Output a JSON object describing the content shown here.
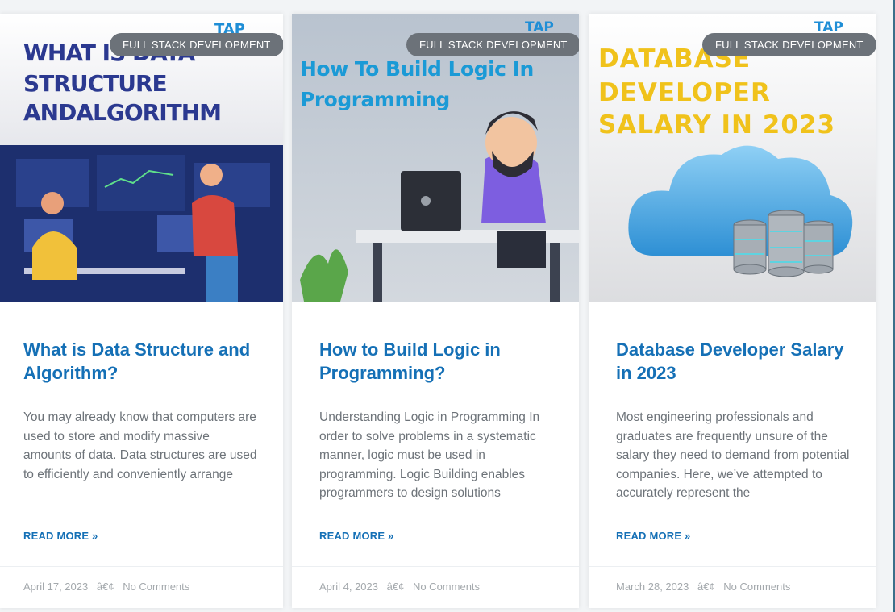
{
  "colors": {
    "accent": "#1570b6",
    "badge_bg": "#6c7279",
    "text_muted": "#6d7379",
    "meta": "#a4a9ad"
  },
  "posts": [
    {
      "category": "FULL STACK DEVELOPMENT",
      "image_text": "WHAT IS DATA STRUCTURE ANDALGORITHM",
      "image_brand": "TAP",
      "title": "What is Data Structure and Algorithm?",
      "excerpt": "You may already know that computers are used to store and modify massive amounts of data. Data structures are used to efficiently and conveniently arrange",
      "read_more": "READ MORE »",
      "date": "April 17, 2023",
      "separator": "â€¢",
      "comments": "No Comments"
    },
    {
      "category": "FULL STACK DEVELOPMENT",
      "image_text": "How To Build Logic In Programming",
      "image_brand": "TAP",
      "title": "How to Build Logic in Programming?",
      "excerpt": "Understanding Logic in Programming In order to solve problems in a systematic manner, logic must be used in programming. Logic Building enables programmers to design solutions",
      "read_more": "READ MORE »",
      "date": "April 4, 2023",
      "separator": "â€¢",
      "comments": "No Comments"
    },
    {
      "category": "FULL STACK DEVELOPMENT",
      "image_text": "DATABASE DEVELOPER SALARY IN 2023",
      "image_brand": "TAP",
      "title": "Database Developer Salary in 2023",
      "excerpt": "Most engineering professionals and graduates are frequently unsure of the salary they need to demand from potential companies. Here, we’ve attempted to accurately represent the",
      "read_more": "READ MORE »",
      "date": "March 28, 2023",
      "separator": "â€¢",
      "comments": "No Comments"
    }
  ]
}
